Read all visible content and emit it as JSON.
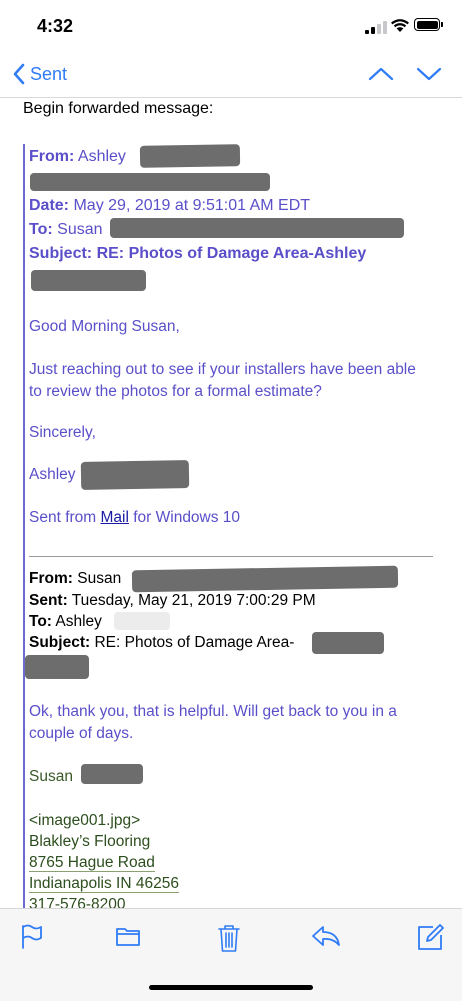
{
  "status_bar": {
    "time": "4:32"
  },
  "nav": {
    "back_label": "Sent"
  },
  "message": {
    "intro": "Begin forwarded message:",
    "forwarded": {
      "from_label": "From:",
      "from_value": "Ashley",
      "date_label": "Date:",
      "date_value": "May 29, 2019 at 9:51:01 AM EDT",
      "to_label": "To:",
      "to_value": "Susan",
      "subject_label": "Subject:",
      "subject_value": "RE: Photos of Damage Area-Ashley",
      "greeting": "Good Morning Susan,",
      "body": "Just reaching out to see if your installers have been able to review the photos for a formal estimate?",
      "closing": "Sincerely,",
      "signature": "Ashley",
      "sent_from_prefix": "Sent from ",
      "sent_from_link": "Mail",
      "sent_from_suffix": " for Windows 10"
    },
    "earlier": {
      "from_label": "From:",
      "from_value": "Susan",
      "sent_label": "Sent:",
      "sent_value": "Tuesday, May 21, 2019 7:00:29 PM",
      "to_label": "To:",
      "to_value": "Ashley",
      "subject_label": "Subject:",
      "subject_value": "RE: Photos of Damage Area-",
      "body": "Ok, thank you, that is helpful.  Will get back to you in a couple of days.",
      "signature": "Susan",
      "image_ref": "<image001.jpg>",
      "company": "Blakley’s Flooring",
      "street": "8765 Hague Road",
      "city": "Indianapolis IN 46256",
      "phone": "317-576-8200"
    }
  },
  "toolbar": {
    "icons": [
      "flag-icon",
      "folder-icon",
      "trash-icon",
      "reply-icon",
      "compose-icon"
    ]
  },
  "colors": {
    "accent": "#2f7cf6",
    "quote_text": "#5a4fc9",
    "link": "#1a1aa6"
  }
}
